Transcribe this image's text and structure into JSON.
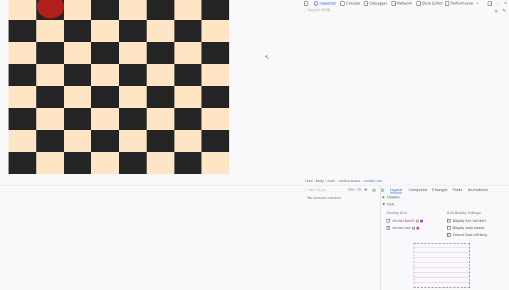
{
  "board": {
    "light_color": "#fde5c6",
    "dark_color": "#242424",
    "piece_color": "#b0201f"
  },
  "toolbar": {
    "inspector": "Inspector",
    "console": "Console",
    "debugger": "Debugger",
    "network": "Network",
    "style_editor": "Style Editor",
    "performance": "Performance",
    "more": "»"
  },
  "search_html_placeholder": "Search HTML",
  "breadcrumbs": {
    "items": [
      "html",
      "body",
      "main",
      "section.board"
    ],
    "current": "section.row"
  },
  "rules_panel": {
    "filter_placeholder": "Filter Styles",
    "hov": ":hov",
    "cls": ".cls",
    "message": "No element selected."
  },
  "tabs": [
    "Layout",
    "Computed",
    "Changes",
    "Fonts",
    "Animations"
  ],
  "layout": {
    "flexbox": "Flexbox",
    "grid": "Grid",
    "overlay_grid_title": "Overlay Grid",
    "overlay_items": [
      "section.board",
      "section.row"
    ],
    "overlay_colors": [
      "#9b34c4",
      "#c23ab0"
    ],
    "display_title": "Grid Display Settings",
    "display_items": [
      "Display line numbers",
      "Display area names",
      "Extend lines infinitely"
    ]
  }
}
